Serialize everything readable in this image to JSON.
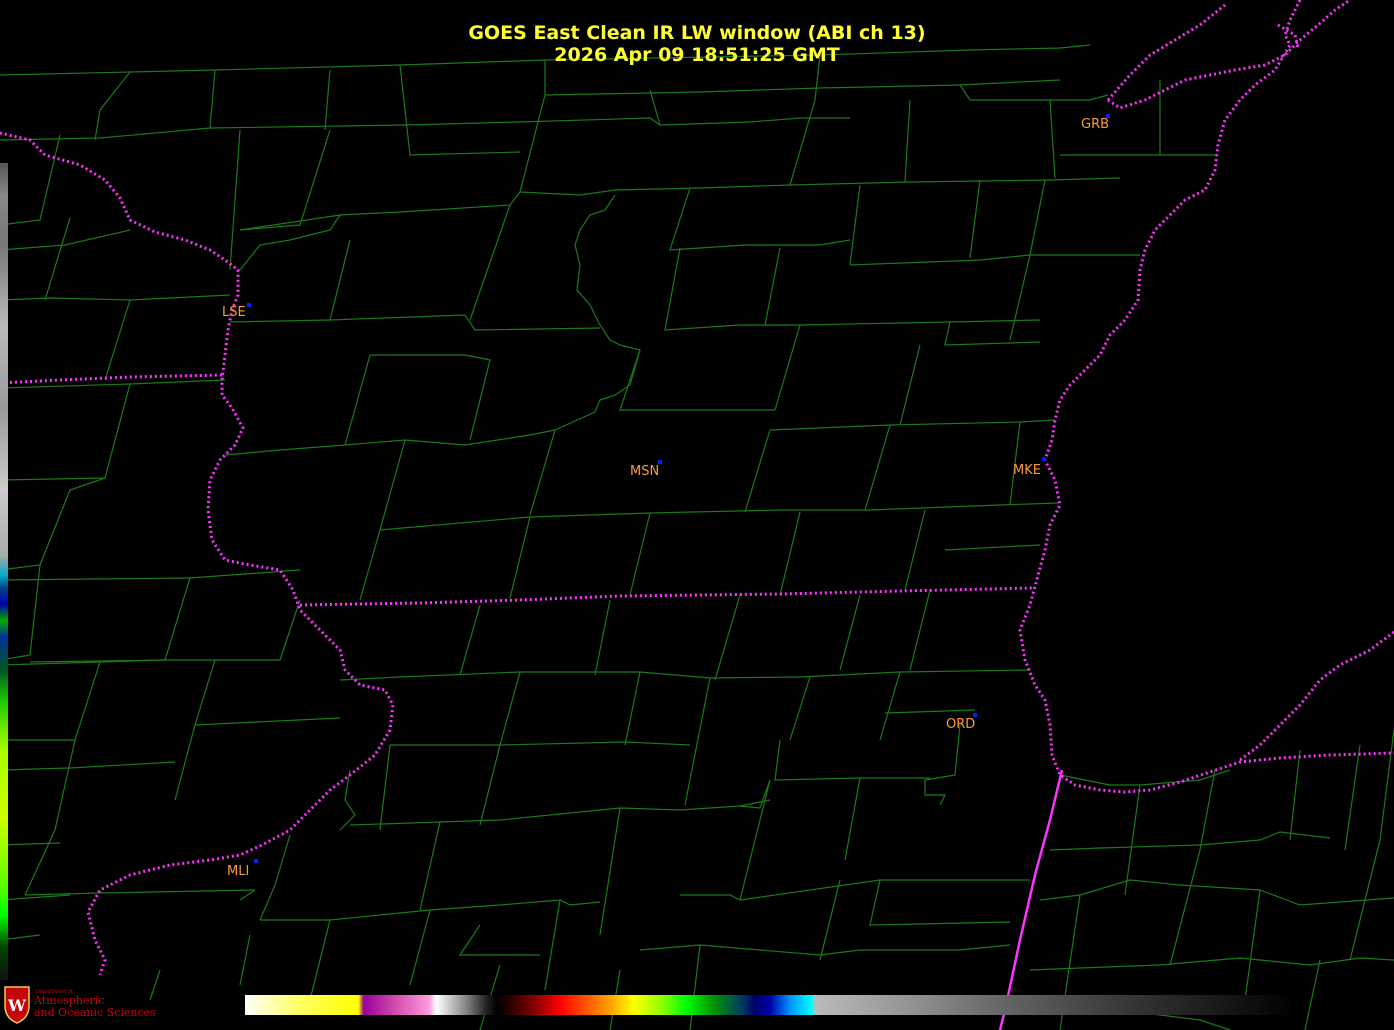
{
  "map": {
    "title_line1": "GOES East Clean IR LW window (ABI ch 13)",
    "title_line2": "2026 Apr 09  18:51:25 GMT",
    "background_color": "#000000",
    "county_line_color": "#1a7a1a",
    "state_line_color": "#ff33ff",
    "title_color": "#ffff33",
    "station_label_color": "#ff9933",
    "station_dot_color": "#0022ff",
    "stations": [
      {
        "id": "GRB",
        "label": "GRB"
      },
      {
        "id": "LSE",
        "label": "LSE"
      },
      {
        "id": "MSN",
        "label": "MSN"
      },
      {
        "id": "MKE",
        "label": "MKE"
      },
      {
        "id": "ORD",
        "label": "ORD"
      },
      {
        "id": "MLI",
        "label": "MLI"
      }
    ],
    "colorbar": {
      "name": "ir-temperature-colorbar"
    },
    "logo": {
      "line_small": "Department of",
      "line1": "Atmospheric",
      "line2": "and Oceanic Sciences",
      "emblem": "W"
    }
  }
}
